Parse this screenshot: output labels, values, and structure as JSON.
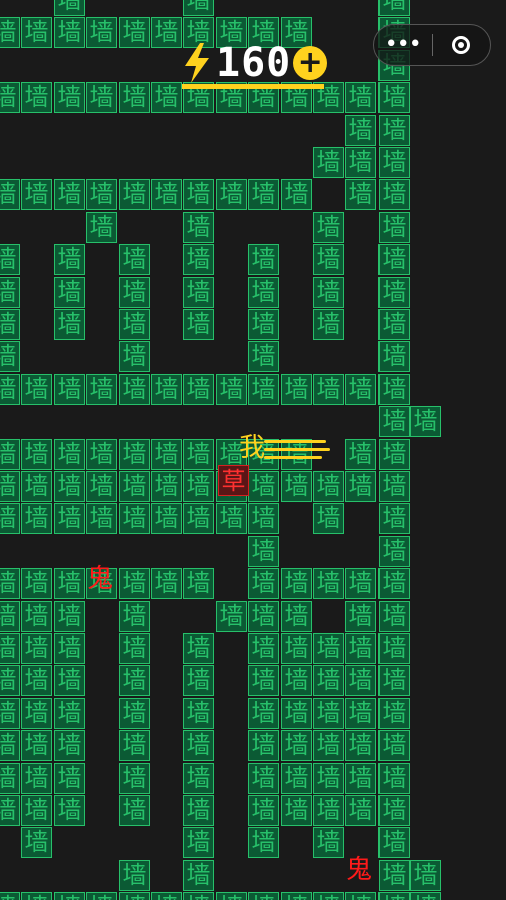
{
  "hud": {
    "energy": "160",
    "plus": "+"
  },
  "capsule": {
    "more": "•••"
  },
  "maze": {
    "wall_char": "墙",
    "rows": [
      "..#...#.....#..",
      "##########..#..",
      "............#..",
      "#############..",
      "...........#...",
      "..........##...",
      "##########.#...",
      "...#..#...#....",
      "#.#.#.#.#.#.#..",
      "#.#.#.#.#.#.#..",
      "#.#.#.#.#.#.#..",
      "#...#...#...#..",
      "#############..",
      ".............#.",
      "##########.#...",
      "############...",
      "#########.#....",
      "........#......",
      "#######.#####..",
      "###.#..###.#...",
      "###.#.#.#####..",
      "###.#.#.#####..",
      "###.#.#.#####..",
      "###.#.#.#####..",
      "###.#.#.#####..",
      "###.#.#.#####..",
      ".#....#.#.#.#..",
      "....#.#......#.",
      "##############."
    ]
  },
  "sprites": {
    "player": "我",
    "grass": "草",
    "ghosts": [
      "鬼",
      "鬼"
    ]
  }
}
